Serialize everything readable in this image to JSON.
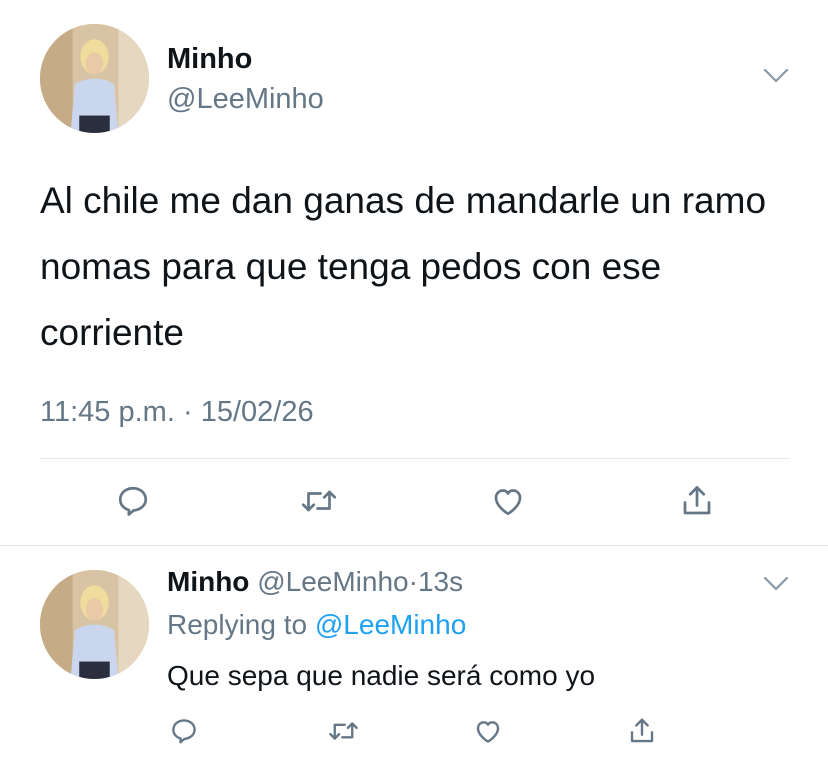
{
  "main_tweet": {
    "author_name": "Minho",
    "author_handle": "@LeeMinho",
    "text": "Al chile me dan ganas de mandarle un ramo nomas para que tenga pedos con ese corriente",
    "time": "11:45 p.m.",
    "separator": "·",
    "date": "15/02/26",
    "actions": [
      "reply-icon",
      "retweet-icon",
      "like-icon",
      "share-icon"
    ]
  },
  "reply_tweet": {
    "author_name": "Minho",
    "author_handle": "@LeeMinho",
    "separator": "·",
    "age": "13s",
    "replying_prefix": "Replying to",
    "replying_to": "@LeeMinho",
    "text": "Que sepa que nadie será como yo",
    "actions": [
      "reply-icon",
      "retweet-icon",
      "like-icon",
      "share-icon"
    ]
  },
  "colors": {
    "text": "#0f1419",
    "secondary": "#657786",
    "link": "#1da1f2",
    "divider": "#e1e8ed"
  }
}
